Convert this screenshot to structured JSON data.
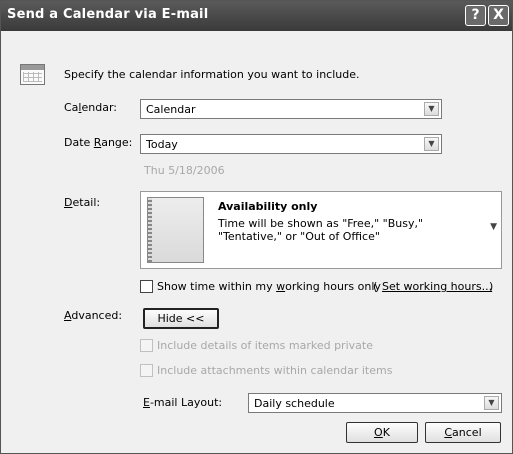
{
  "window": {
    "title": "Send a Calendar via E-mail",
    "help_glyph": "?",
    "close_glyph": "X"
  },
  "intro": {
    "text": "Specify the calendar information you want to include."
  },
  "calendar": {
    "label_pre": "Ca",
    "label_key": "l",
    "label_post": "endar:",
    "value": "Calendar"
  },
  "date_range": {
    "label_pre": "Date ",
    "label_key": "R",
    "label_post": "ange:",
    "value": "Today",
    "date_hint": "Thu 5/18/2006"
  },
  "detail": {
    "label_pre": "",
    "label_key": "D",
    "label_post": "etail:",
    "title": "Availability only",
    "description": "Time will be shown as \"Free,\" \"Busy,\" \"Tentative,\" or \"Out of Office\""
  },
  "working_hours": {
    "label_pre": "Show time within my ",
    "label_key": "w",
    "label_post": "orking hours only",
    "paren_open": "(",
    "link_text": "Set working hours...",
    "paren_close": ")",
    "checked": false
  },
  "advanced": {
    "label_pre": "",
    "label_key": "A",
    "label_post": "dvanced:",
    "toggle_label": "Hide <<",
    "private_label": "Include details of items marked private",
    "attachments_label": "Include attachments within calendar items"
  },
  "email_layout": {
    "label_pre": "",
    "label_key": "E",
    "label_post": "-mail Layout:",
    "value": "Daily schedule"
  },
  "buttons": {
    "ok_key": "O",
    "ok_rest": "K",
    "cancel_key": "C",
    "cancel_rest": "ancel"
  },
  "icons": {
    "dropdown": "chevron-down-icon",
    "calendar": "calendar-icon"
  }
}
